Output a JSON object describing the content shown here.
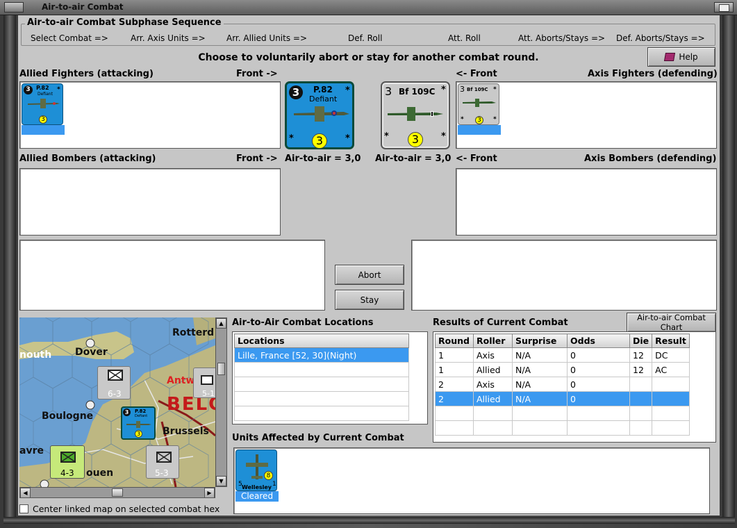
{
  "window": {
    "title": "Air-to-air Combat"
  },
  "sequence": {
    "title": "Air-to-air Combat Subphase Sequence",
    "steps": [
      "Select Combat =>",
      "Arr. Axis Units =>",
      "Arr. Allied Units =>",
      "Def. Roll",
      "Att. Roll",
      "Att. Aborts/Stays =>",
      "Def. Aborts/Stays =>"
    ]
  },
  "prompt": "Choose to voluntarily abort or stay for another combat round.",
  "help_label": "Help",
  "allied_fighters": {
    "label": "Allied Fighters (attacking)",
    "front": "Front ->"
  },
  "axis_fighters": {
    "label": "Axis Fighters (defending)",
    "front": "<- Front"
  },
  "allied_bombers": {
    "label": "Allied Bombers (attacking)",
    "front": "Front ->"
  },
  "axis_bombers": {
    "label": "Axis Bombers (defending)",
    "front": "<- Front"
  },
  "allied_unit": {
    "name_top": "P.82",
    "name_bottom": "Defiant",
    "rating": "3",
    "strength": "3",
    "air_to_air": "Air-to-air = 3,0",
    "star": "*"
  },
  "axis_unit": {
    "name": "Bf 109C",
    "rating": "3",
    "strength": "3",
    "air_to_air": "Air-to-air = 3,0",
    "star": "*"
  },
  "buttons": {
    "abort": "Abort",
    "stay": "Stay",
    "chart": "Air-to-air Combat Chart"
  },
  "locations": {
    "title": "Air-to-Air Combat Locations",
    "header": "Locations",
    "items": [
      "Lille, France [52, 30](Night)"
    ]
  },
  "results": {
    "title": "Results of Current Combat",
    "headers": [
      "Round",
      "Roller",
      "Surprise",
      "Odds",
      "Die",
      "Result"
    ],
    "rows": [
      [
        "1",
        "Axis",
        "N/A",
        "0",
        "12",
        "DC"
      ],
      [
        "1",
        "Allied",
        "N/A",
        "0",
        "12",
        "AC"
      ],
      [
        "2",
        "Axis",
        "N/A",
        "0",
        "",
        ""
      ],
      [
        "2",
        "Allied",
        "N/A",
        "0",
        "",
        ""
      ]
    ]
  },
  "affected": {
    "title": "Units Affected by Current Combat",
    "unit_name": "Wellesley",
    "unit_strength": "8",
    "unit_left": "5",
    "unit_right": "1",
    "status": "Cleared"
  },
  "map": {
    "cities": [
      "Rotterd",
      "Dover",
      "nouth",
      "Antw",
      "BELG",
      "Boulogne",
      "Brussels",
      "avre",
      "ouen"
    ],
    "units": [
      {
        "value": "6-3",
        "type": "inf",
        "size": "XXX",
        "mark": "R"
      },
      {
        "value": "5-1",
        "type": "inf",
        "size": "XXX"
      },
      {
        "value": "4-3",
        "type": "inf",
        "size": "XXX",
        "mark": "R"
      },
      {
        "value": "5-3",
        "type": "inf",
        "size": "XXX"
      }
    ],
    "fighter": {
      "name_top": "P.82",
      "name_bottom": "Defiant",
      "rating": "3",
      "strength": "3"
    }
  },
  "center_map_label": "Center linked map on selected combat hex",
  "colors": {
    "panel": "#c6c6c6",
    "selection": "#3b99f0",
    "allied": "#1e8fd6",
    "axis_counter": "#c9c9c9"
  }
}
